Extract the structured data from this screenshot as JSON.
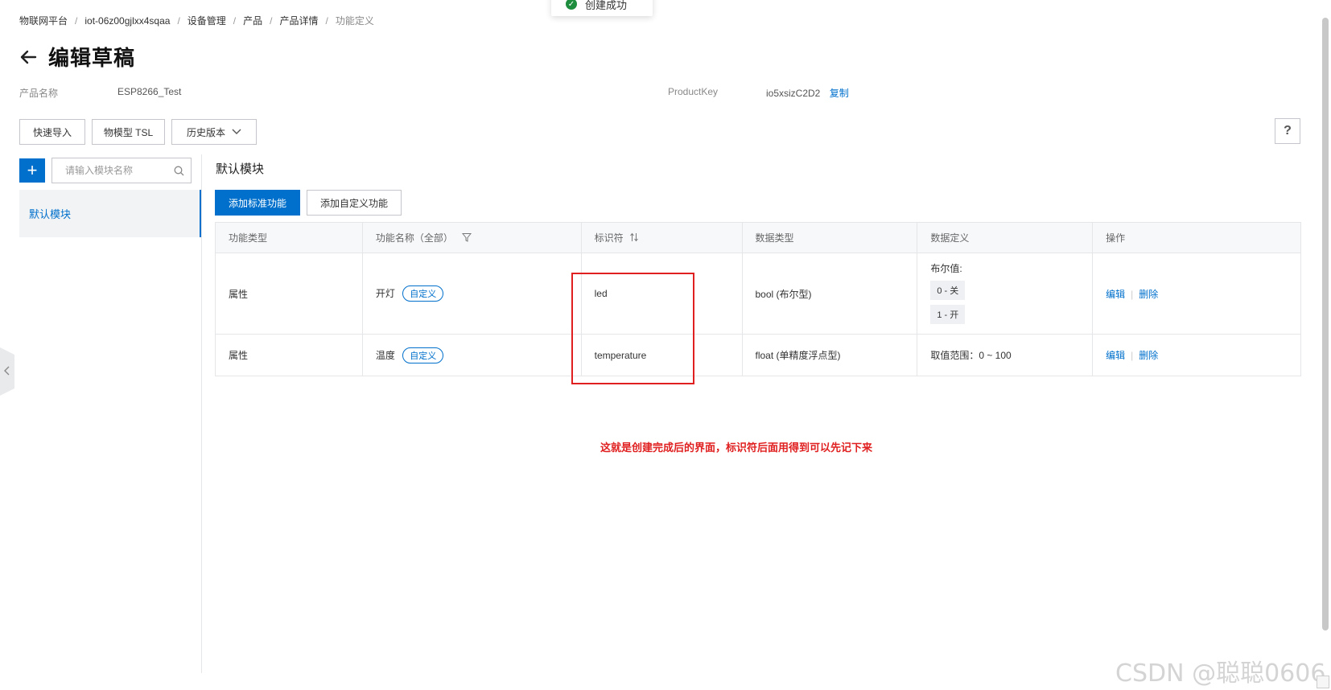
{
  "toast": {
    "text": "创建成功"
  },
  "breadcrumb": [
    "物联网平台",
    "iot-06z00gjlxx4sqaa",
    "设备管理",
    "产品",
    "产品详情",
    "功能定义"
  ],
  "page": {
    "title": "编辑草稿"
  },
  "product": {
    "name_label": "产品名称",
    "name_value": "ESP8266_Test",
    "key_label": "ProductKey",
    "key_value": "io5xsizC2D2",
    "copy_label": "复制"
  },
  "toolbar": {
    "quick_import": "快速导入",
    "tsl": "物模型 TSL",
    "history": "历史版本",
    "help": "?"
  },
  "sidebar": {
    "add_label": "+",
    "search_placeholder": "请输入模块名称",
    "items": [
      {
        "label": "默认模块"
      }
    ]
  },
  "main": {
    "section_title": "默认模块",
    "add_standard": "添加标准功能",
    "add_custom": "添加自定义功能",
    "columns": [
      "功能类型",
      "功能名称（全部）",
      "标识符",
      "数据类型",
      "数据定义",
      "操作"
    ],
    "rows": [
      {
        "type": "属性",
        "name": "开灯",
        "tag": "自定义",
        "identifier": "led",
        "data_type": "bool (布尔型)",
        "def_title": "布尔值:",
        "def_values": [
          "0 - 关",
          "1 - 开"
        ],
        "edit": "编辑",
        "delete": "删除"
      },
      {
        "type": "属性",
        "name": "温度",
        "tag": "自定义",
        "identifier": "temperature",
        "data_type": "float (单精度浮点型)",
        "def_text": "取值范围：0 ~ 100",
        "edit": "编辑",
        "delete": "删除"
      }
    ]
  },
  "annotation": "这就是创建完成后的界面，标识符后面用得到可以先记下来",
  "watermark": "CSDN @聪聪0606",
  "colors": {
    "primary": "#0070cc",
    "annotation": "#e02020"
  }
}
